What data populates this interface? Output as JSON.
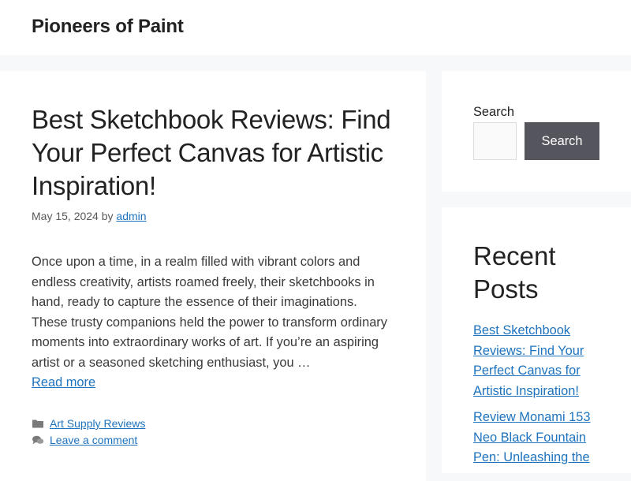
{
  "site": {
    "title": "Pioneers of Paint"
  },
  "post": {
    "title": "Best Sketchbook Reviews: Find Your Perfect Canvas for Artistic Inspiration!",
    "date": "May 15, 2024",
    "by": "by",
    "author": "admin",
    "excerpt": "Once upon a time, in a realm filled with vibrant colors and endless creativity, artists roamed freely, their sketchbooks in hand, ready to capture the essence of their imaginations. These trusty companions held the power to transform ordinary moments into extraordinary works of art. If you’re an aspiring artist or a seasoned sketching enthusiast, you …",
    "read_more": "Read more",
    "category_icon": "folder-icon",
    "category": "Art Supply Reviews",
    "comment_icon": "comment-icon",
    "comment_link": "Leave a comment"
  },
  "sidebar": {
    "search_label": "Search",
    "search_value": "",
    "search_button": "Search",
    "recent_title": "Recent Posts",
    "recent_posts": [
      {
        "label": "Best Sketchbook Reviews: Find Your Perfect Canvas for Artistic Inspiration!"
      },
      {
        "label": "Review Monami 153 Neo Black Fountain Pen: Unleashing the"
      }
    ]
  },
  "colors": {
    "page_background": "#f7f8f9",
    "link": "#1e73be",
    "button": "#55555e",
    "text": "#222222"
  }
}
